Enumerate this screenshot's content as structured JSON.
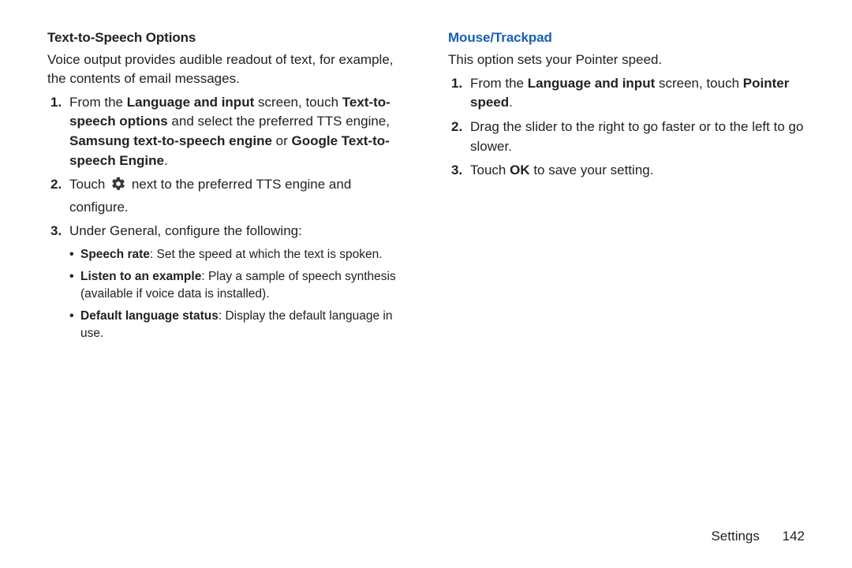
{
  "left": {
    "title": "Text-to-Speech Options",
    "intro": "Voice output provides audible readout of text, for example, the contents of email messages.",
    "steps": [
      {
        "parts": [
          {
            "t": "From the "
          },
          {
            "t": "Language and input",
            "b": true
          },
          {
            "t": " screen, touch "
          },
          {
            "t": "Text-to-speech options",
            "b": true
          },
          {
            "t": " and select the preferred TTS engine, "
          },
          {
            "t": "Samsung text-to-speech engine",
            "b": true
          },
          {
            "t": " or "
          },
          {
            "t": "Google Text-to-speech Engine",
            "b": true
          },
          {
            "t": "."
          }
        ]
      },
      {
        "parts": [
          {
            "t": "Touch "
          },
          {
            "icon": "gear"
          },
          {
            "t": " next to the preferred TTS engine and configure."
          }
        ]
      },
      {
        "parts": [
          {
            "t": "Under General, configure the following:"
          }
        ],
        "bullets": [
          [
            {
              "t": "Speech rate",
              "b": true
            },
            {
              "t": ": Set the speed at which the text is spoken."
            }
          ],
          [
            {
              "t": "Listen to an example",
              "b": true
            },
            {
              "t": ": Play a sample of speech synthesis (available if voice data is installed)."
            }
          ],
          [
            {
              "t": "Default language status",
              "b": true
            },
            {
              "t": ": Display the default language in use."
            }
          ]
        ]
      }
    ]
  },
  "right": {
    "title": "Mouse/Trackpad",
    "intro": "This option sets your Pointer speed.",
    "steps": [
      {
        "parts": [
          {
            "t": "From the "
          },
          {
            "t": "Language and input",
            "b": true
          },
          {
            "t": " screen, touch "
          },
          {
            "t": "Pointer speed",
            "b": true
          },
          {
            "t": "."
          }
        ]
      },
      {
        "parts": [
          {
            "t": "Drag the slider to the right to go faster or to the left to go slower."
          }
        ]
      },
      {
        "parts": [
          {
            "t": "Touch "
          },
          {
            "t": "OK",
            "b": true
          },
          {
            "t": " to save your setting."
          }
        ]
      }
    ]
  },
  "footer": {
    "section": "Settings",
    "page": "142"
  }
}
